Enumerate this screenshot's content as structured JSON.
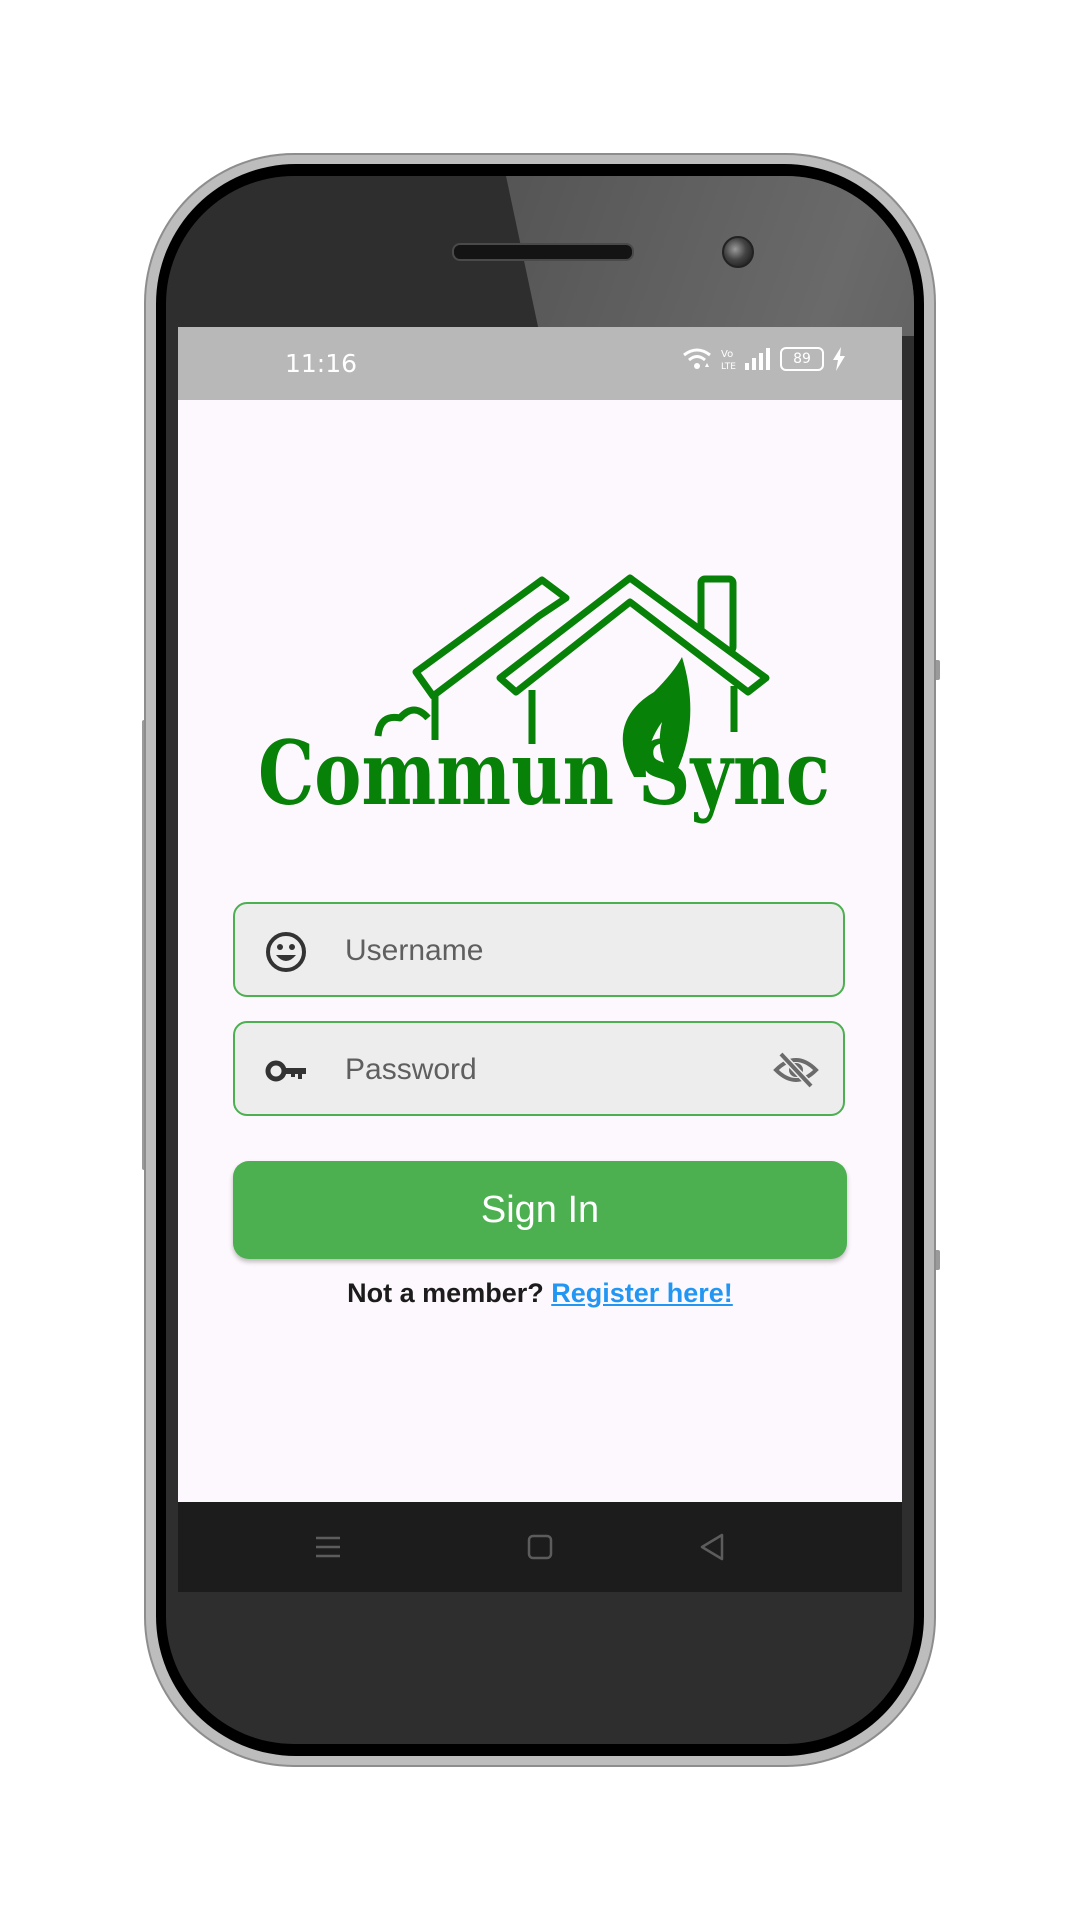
{
  "status_bar": {
    "time": "11:16",
    "battery_level": "89",
    "icons": [
      "wifi-icon",
      "volte-icon",
      "signal-icon",
      "battery-icon",
      "charging-icon"
    ]
  },
  "brand": {
    "name_part1": "Commun",
    "name_part2": "Sync",
    "color": "#078107"
  },
  "login_form": {
    "username_placeholder": "Username",
    "password_placeholder": "Password",
    "username_icon": "smiley-icon",
    "password_icon": "key-icon",
    "visibility_icon": "eye-off-icon",
    "sign_in_label": "Sign In",
    "register_prompt": "Not a member?",
    "register_link": "Register here!"
  },
  "nav_bar": {
    "icons": [
      "menu-icon",
      "home-icon",
      "back-icon"
    ]
  },
  "colors": {
    "accent": "#4caf50",
    "link": "#2196f3",
    "field_background": "#ededed",
    "screen_background": "#fdf8fd",
    "status_bar": "#b9b8b9"
  }
}
